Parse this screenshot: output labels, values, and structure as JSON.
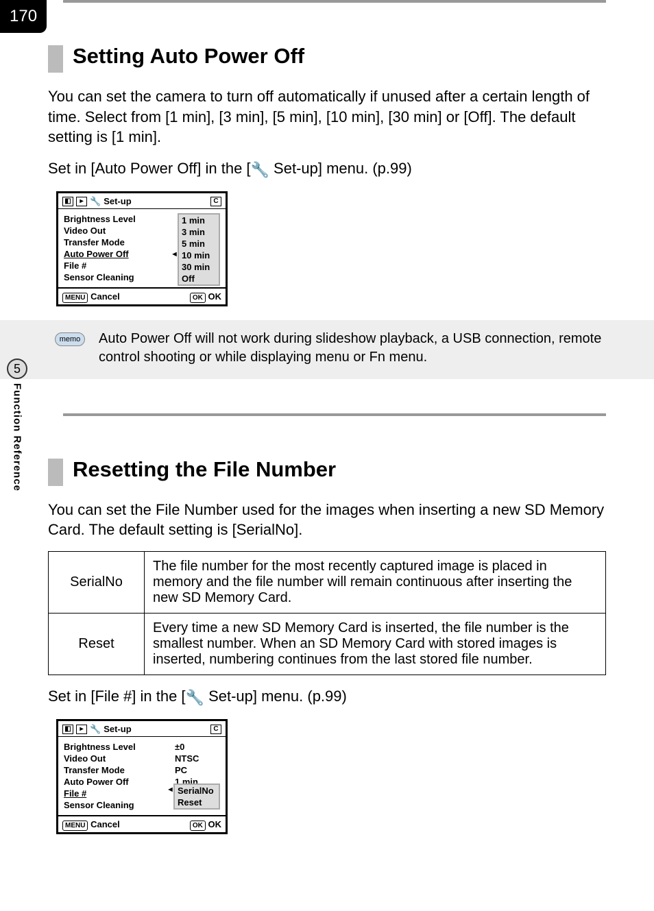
{
  "page_number": "170",
  "side": {
    "number": "5",
    "label": "Function Reference"
  },
  "section1": {
    "title": "Setting Auto Power Off",
    "para": "You can set the camera to turn off automatically if unused after a certain length of time. Select from [1 min], [3 min], [5 min], [10 min], [30 min] or [Off]. The default setting is [1 min].",
    "para2_pre": "Set in [Auto Power Off] in the [",
    "para2_post": " Set-up] menu. (p.99)"
  },
  "menu1": {
    "title": "Set-up",
    "tab_c": "C",
    "rows": [
      {
        "label": "Brightness Level",
        "val": ""
      },
      {
        "label": "Video Out",
        "val": ""
      },
      {
        "label": "Transfer Mode",
        "val": ""
      },
      {
        "label": "Auto Power Off",
        "val": "",
        "selected": true
      },
      {
        "label": "File #",
        "val": ""
      },
      {
        "label": "Sensor Cleaning",
        "val": ""
      }
    ],
    "options": [
      "1 min",
      "3 min",
      "5 min",
      "10 min",
      "30 min",
      "Off"
    ],
    "option_selected_index": 3,
    "footer_left_btn": "MENU",
    "footer_left_txt": "Cancel",
    "footer_right_btn": "OK",
    "footer_right_txt": "OK"
  },
  "memo": {
    "badge": "memo",
    "text": "Auto Power Off will not work during slideshow playback, a USB connection, remote control shooting or while displaying menu or Fn menu."
  },
  "section2": {
    "title": "Resetting the File Number",
    "para": "You can set the File Number used for the images when inserting a new SD Memory Card. The default setting is [SerialNo].",
    "table": [
      {
        "key": "SerialNo",
        "desc": "The file number for the most recently captured image is placed in memory and the file number will remain continuous after inserting the new SD Memory Card."
      },
      {
        "key": "Reset",
        "desc": "Every time a new SD Memory Card is inserted, the file number is the smallest number. When an SD Memory Card with stored images is inserted, numbering continues from the last stored file number."
      }
    ],
    "para2_pre": "Set in [File #] in the [",
    "para2_post": " Set-up] menu. (p.99)"
  },
  "menu2": {
    "title": "Set-up",
    "tab_c": "C",
    "rows": [
      {
        "label": "Brightness Level",
        "val": "±0"
      },
      {
        "label": "Video Out",
        "val": "NTSC"
      },
      {
        "label": "Transfer Mode",
        "val": "PC"
      },
      {
        "label": "Auto Power Off",
        "val": "1 min"
      },
      {
        "label": "File #",
        "val": "",
        "selected": true
      },
      {
        "label": "Sensor Cleaning",
        "val": ""
      }
    ],
    "options": [
      "SerialNo",
      "Reset"
    ],
    "option_selected_index": 0,
    "footer_left_btn": "MENU",
    "footer_left_txt": "Cancel",
    "footer_right_btn": "OK",
    "footer_right_txt": "OK"
  },
  "icons": {
    "wrench": "🔧"
  },
  "chart_data": null
}
